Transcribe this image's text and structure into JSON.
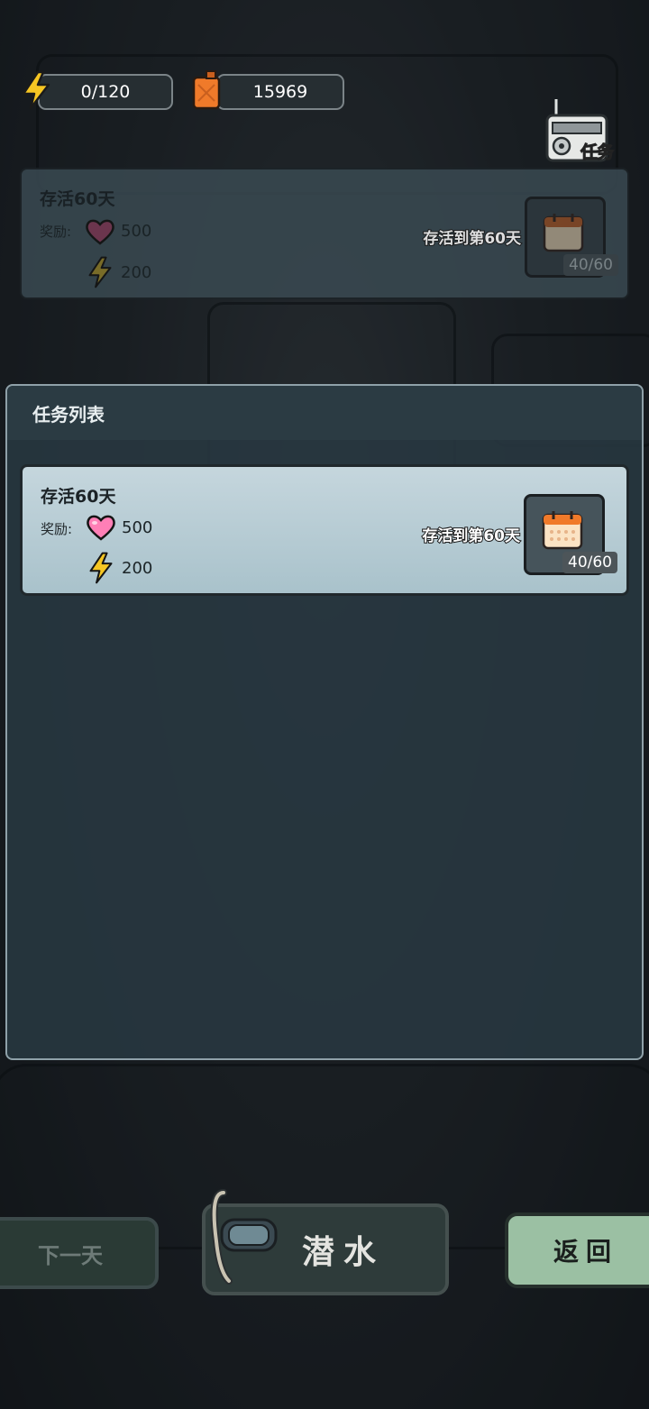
{
  "resources": {
    "energy": "0/120",
    "fuel": "15969"
  },
  "radio": {
    "label": "任务"
  },
  "background_quest": {
    "title": "存活60天",
    "reward_label": "奖励:",
    "reward_heart": "500",
    "reward_energy": "200",
    "goal": "存活到第60天",
    "progress": "40/60"
  },
  "panel": {
    "title": "任务列表",
    "quests": [
      {
        "title": "存活60天",
        "reward_label": "奖励:",
        "reward_heart": "500",
        "reward_energy": "200",
        "goal": "存活到第60天",
        "progress": "40/60"
      }
    ]
  },
  "buttons": {
    "next_day": "下一天",
    "dive": "潜水",
    "back": "返回"
  },
  "colors": {
    "card_active": "#bcd0d7",
    "heart": "#ff7fb6",
    "energy": "#f6c623",
    "fuel": "#f07a2a",
    "back_button": "#9bc0a3"
  },
  "icons": [
    "energy-icon",
    "fuel-can-icon",
    "radio-icon",
    "heart-icon",
    "calendar-icon",
    "snorkel-icon"
  ]
}
